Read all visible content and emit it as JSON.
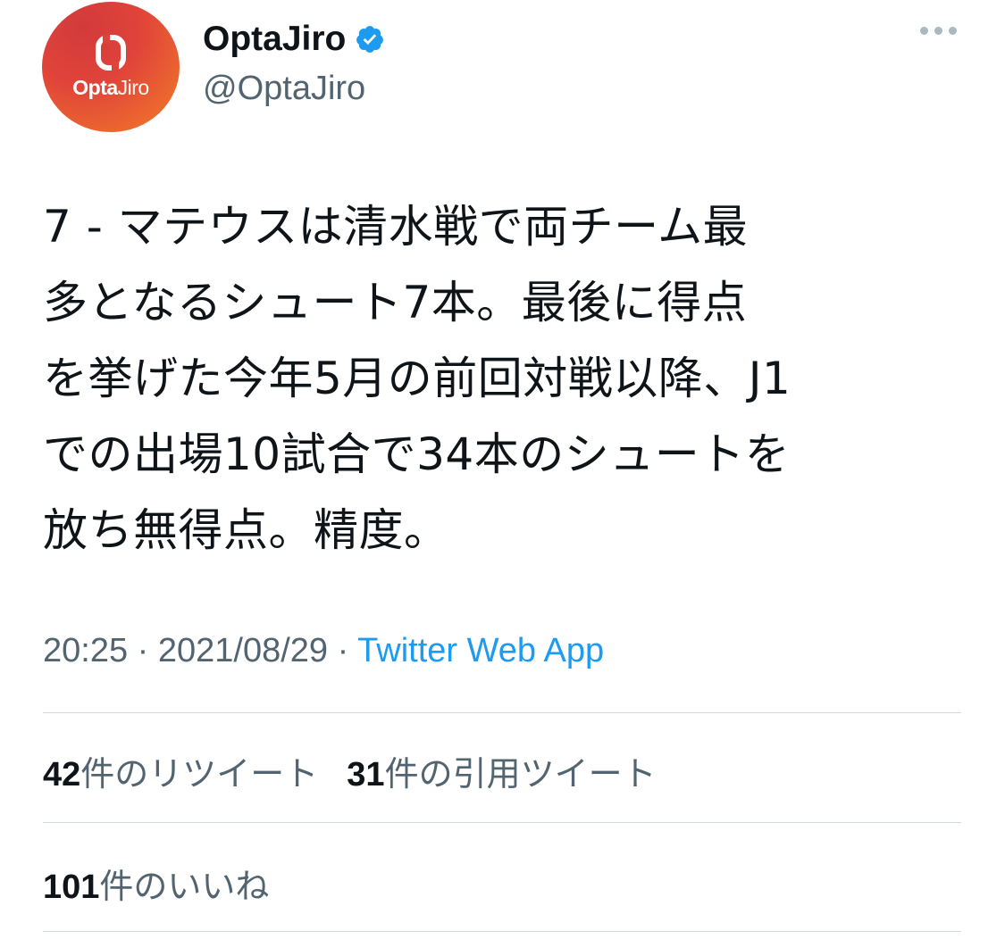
{
  "account": {
    "avatar_text_bold": "Opta",
    "avatar_text_light": "Jiro",
    "display_name": "OptaJiro",
    "handle": "@OptaJiro",
    "verified_icon": "verified-badge-icon",
    "more_icon": "more-horizontal-icon"
  },
  "tweet": {
    "text": "7 - マテウスは清水戦で両チーム最\n多となるシュート7本。最後に得点\nを挙げた今年5月の前回対戦以降、J1\nでの出場10試合で34本のシュートを\n放ち無得点。精度。",
    "time": "20:25",
    "date": "2021/08/29",
    "separator": "·",
    "source": "Twitter Web App"
  },
  "stats": {
    "retweets_count": "42",
    "retweets_label": "件のリツイート",
    "quotes_count": "31",
    "quotes_label": "件の引用ツイート",
    "likes_count": "101",
    "likes_label": "件のいいね"
  },
  "colors": {
    "accent": "#1d9bf0",
    "secondary_text": "#536471",
    "avatar_orange": "#ec6a2e",
    "avatar_red": "#d23a3a"
  }
}
